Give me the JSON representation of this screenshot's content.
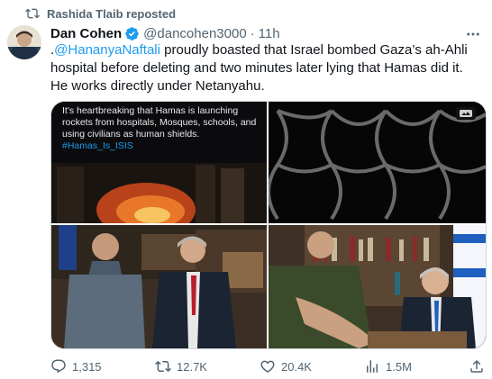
{
  "repost": {
    "label": "Rashida Tlaib reposted"
  },
  "tweet": {
    "display_name": "Dan Cohen",
    "handle": "@dancohen3000",
    "separator": "·",
    "time": "11h",
    "text_prefix": ".",
    "mention": "@HananyaNaftali",
    "text_body": " proudly boasted that Israel bombed Gaza’s ah-Ahli hospital before deleting and two minutes later lying that Hamas did it. He works directly under Netanyahu."
  },
  "media": {
    "image1_text": "It's heartbreaking that Hamas is launching rockets from hospitals, Mosques, schools, and using civilians as human shields.",
    "image1_hashtag": "#Hamas_Is_ISIS"
  },
  "actions": {
    "replies": "1,315",
    "reposts": "12.7K",
    "likes": "20.4K",
    "views": "1.5M"
  },
  "colors": {
    "accent": "#1d9bf0",
    "secondary_text": "#536471",
    "border": "#cfd9de"
  }
}
